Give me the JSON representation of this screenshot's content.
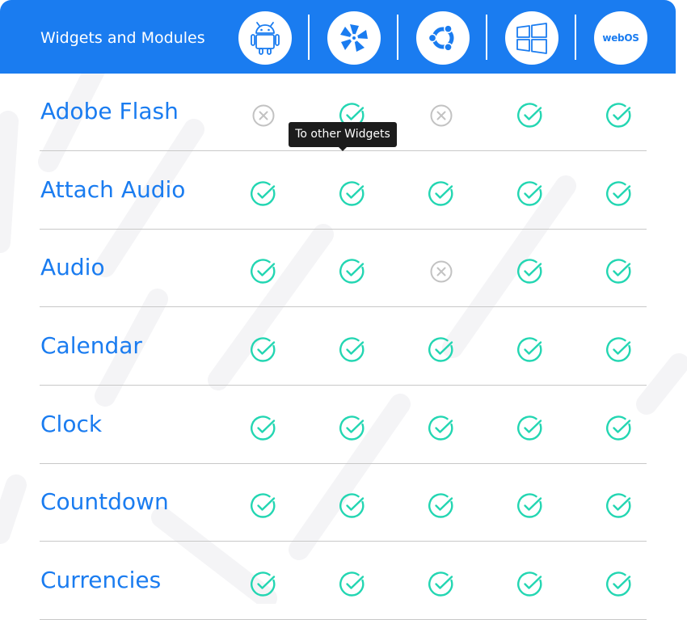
{
  "header": {
    "title": "Widgets and Modules",
    "platforms": [
      {
        "name": "android-icon"
      },
      {
        "name": "tizen-icon"
      },
      {
        "name": "ubuntu-icon"
      },
      {
        "name": "windows-icon"
      },
      {
        "name": "webos-icon",
        "label": "webOS"
      }
    ]
  },
  "tooltip": {
    "text": "To other Widgets"
  },
  "colors": {
    "accent": "#1a7cf0",
    "check": "#23d6b2",
    "cross": "#c2c2c2"
  },
  "rows": [
    {
      "label": "Adobe Flash",
      "support": [
        false,
        true,
        false,
        true,
        true
      ]
    },
    {
      "label": "Attach Audio",
      "support": [
        true,
        true,
        true,
        true,
        true
      ]
    },
    {
      "label": "Audio",
      "support": [
        true,
        true,
        false,
        true,
        true
      ]
    },
    {
      "label": "Calendar",
      "support": [
        true,
        true,
        true,
        true,
        true
      ]
    },
    {
      "label": "Clock",
      "support": [
        true,
        true,
        true,
        true,
        true
      ]
    },
    {
      "label": "Countdown",
      "support": [
        true,
        true,
        true,
        true,
        true
      ]
    },
    {
      "label": "Currencies",
      "support": [
        true,
        true,
        true,
        true,
        true
      ]
    }
  ]
}
